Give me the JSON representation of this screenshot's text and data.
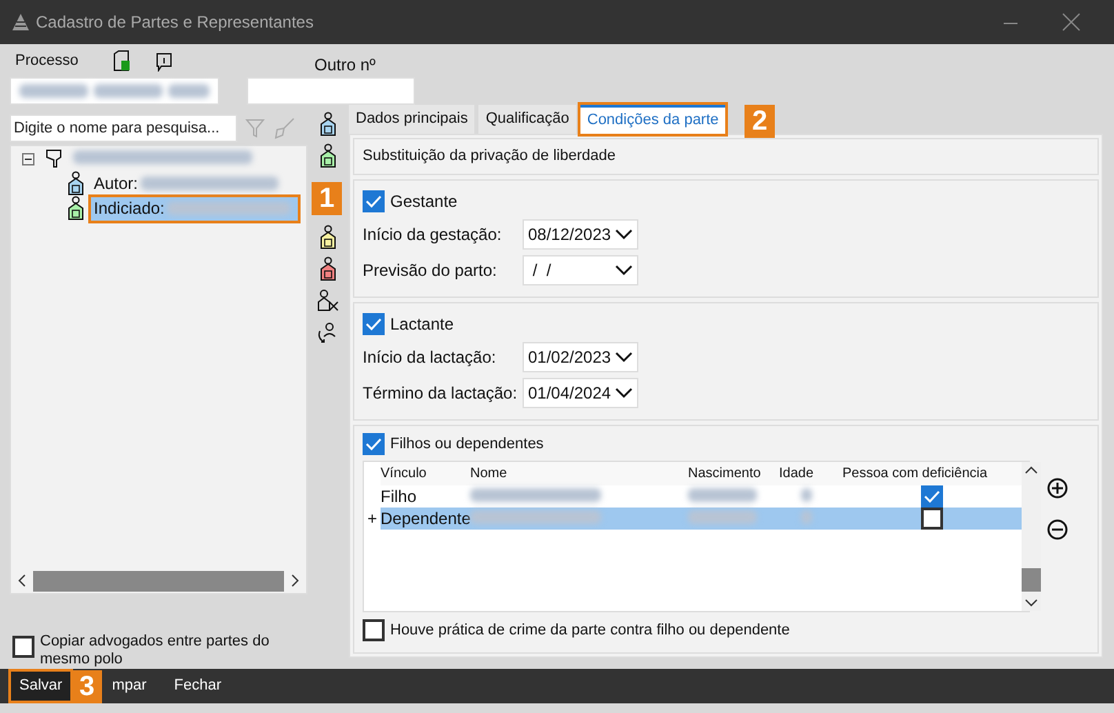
{
  "window": {
    "title": "Cadastro de Partes e Representantes"
  },
  "process": {
    "label": "Processo",
    "other_label": "Outro nº"
  },
  "search": {
    "placeholder": "Digite o nome para pesquisa..."
  },
  "tree": {
    "expanded": true,
    "children": [
      {
        "label": "Autor:",
        "kind": "autor",
        "selected": false
      },
      {
        "label": "Indiciado:",
        "kind": "indiciado",
        "selected": true
      }
    ]
  },
  "side_icons": [
    {
      "kind": "A"
    },
    {
      "kind": "P"
    },
    {
      "kind": "R"
    },
    {
      "kind": "T"
    },
    {
      "kind": "remove"
    },
    {
      "kind": "swap"
    }
  ],
  "copy_lawyers": {
    "label": "Copiar advogados entre partes do mesmo polo",
    "checked": false
  },
  "tabs": [
    {
      "label": "Dados principais",
      "selected": false
    },
    {
      "label": "Qualificação",
      "selected": false
    },
    {
      "label": "Condições da parte",
      "selected": true
    }
  ],
  "section_title": "Substituição da privação de liberdade",
  "gestante": {
    "label": "Gestante",
    "checked": true,
    "fields": [
      {
        "label": "Início da gestação:",
        "value": "08/12/2023"
      },
      {
        "label": "Previsão do parto:",
        "value": " /  /"
      }
    ]
  },
  "lactante": {
    "label": "Lactante",
    "checked": true,
    "fields": [
      {
        "label": "Início da lactação:",
        "value": "01/02/2023"
      },
      {
        "label": "Término da lactação:",
        "value": "01/04/2024"
      }
    ]
  },
  "filhos": {
    "label": "Filhos ou dependentes",
    "checked": true,
    "columns": [
      "Vínculo",
      "Nome",
      "Nascimento",
      "Idade",
      "Pessoa com deficiência"
    ],
    "rows": [
      {
        "vinculo": "Filho",
        "pcd": true,
        "selected": false,
        "new": false
      },
      {
        "vinculo": "Dependente",
        "pcd": false,
        "selected": true,
        "new": true
      }
    ],
    "new_marker": "+"
  },
  "crime": {
    "label": "Houve prática de crime da parte contra filho ou dependente",
    "checked": false
  },
  "footer": [
    {
      "label": "Salvar"
    },
    {
      "label": "mpar"
    },
    {
      "label": "Fechar"
    }
  ],
  "callouts": [
    "1",
    "2",
    "3"
  ]
}
